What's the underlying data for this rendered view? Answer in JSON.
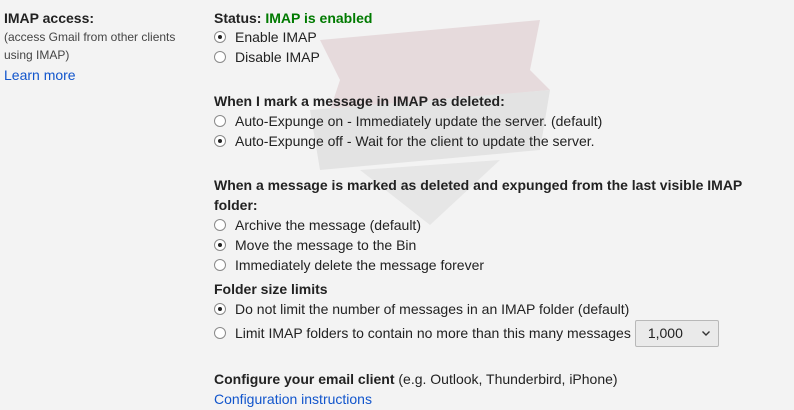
{
  "imap": {
    "title": "IMAP access:",
    "subtitle_line1": "(access Gmail from other clients",
    "subtitle_line2": "using IMAP)",
    "learn_more": "Learn more",
    "status_label": "Status:",
    "status_value": "IMAP is enabled",
    "status_color": "#007a00",
    "options": [
      {
        "label": "Enable IMAP",
        "selected": true
      },
      {
        "label": "Disable IMAP",
        "selected": false
      }
    ]
  },
  "deleted": {
    "heading": "When I mark a message in IMAP as deleted:",
    "options": [
      {
        "label": "Auto-Expunge on - Immediately update the server. (default)",
        "selected": false
      },
      {
        "label": "Auto-Expunge off - Wait for the client to update the server.",
        "selected": true
      }
    ]
  },
  "expunged": {
    "heading": "When a message is marked as deleted and expunged from the last visible IMAP folder:",
    "options": [
      {
        "label": "Archive the message (default)",
        "selected": false
      },
      {
        "label": "Move the message to the Bin",
        "selected": true
      },
      {
        "label": "Immediately delete the message forever",
        "selected": false
      }
    ]
  },
  "folder": {
    "heading": "Folder size limits",
    "options": [
      {
        "label": "Do not limit the number of messages in an IMAP folder (default)",
        "selected": true
      },
      {
        "label": "Limit IMAP folders to contain no more than this many messages",
        "selected": false
      }
    ],
    "limit_value": "1,000"
  },
  "configure": {
    "heading": "Configure your email client",
    "examples": "(e.g. Outlook, Thunderbird, iPhone)",
    "link": "Configuration instructions"
  },
  "colors": {
    "link": "#1155cc",
    "background": "#f3f3f3"
  }
}
